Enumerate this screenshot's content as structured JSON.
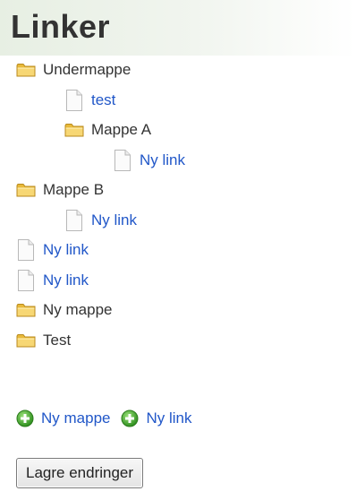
{
  "page": {
    "title": "Linker"
  },
  "tree": {
    "items": [
      {
        "type": "folder",
        "label": "Undermappe",
        "depth": 0
      },
      {
        "type": "link",
        "label": "test",
        "depth": 1
      },
      {
        "type": "folder",
        "label": "Mappe A",
        "depth": 1
      },
      {
        "type": "link",
        "label": "Ny link",
        "depth": 2
      },
      {
        "type": "folder",
        "label": "Mappe B",
        "depth": 0
      },
      {
        "type": "link",
        "label": "Ny link",
        "depth": 1
      },
      {
        "type": "link",
        "label": "Ny link",
        "depth": 0
      },
      {
        "type": "link",
        "label": "Ny link",
        "depth": 0
      },
      {
        "type": "folder",
        "label": "Ny mappe",
        "depth": 0
      },
      {
        "type": "folder",
        "label": "Test",
        "depth": 0
      }
    ]
  },
  "actions": {
    "new_folder_label": "Ny mappe",
    "new_link_label": "Ny link"
  },
  "buttons": {
    "save_label": "Lagre endringer"
  },
  "colors": {
    "link": "#2157c8",
    "text": "#333333",
    "folder": "#f2c84b",
    "plus": "#4caf2e"
  },
  "icons": {
    "folder": "folder-icon",
    "page": "page-icon",
    "add": "plus-circle-icon"
  }
}
